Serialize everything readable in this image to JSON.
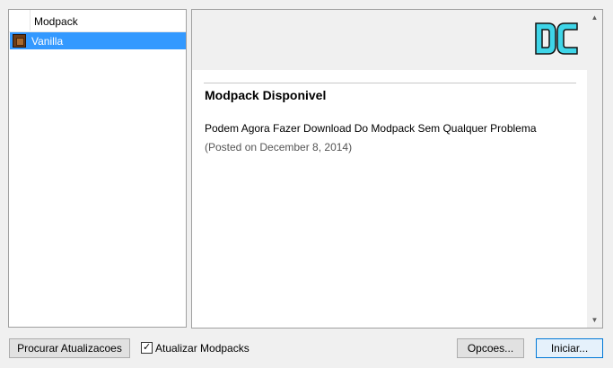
{
  "modpack_list": {
    "column_header": "Modpack",
    "items": [
      {
        "name": "Vanilla",
        "selected": true,
        "icon": "crafting-table-icon"
      }
    ]
  },
  "news": {
    "logo_text": "DC",
    "title": "Modpack Disponivel",
    "body": "Podem Agora Fazer Download Do Modpack Sem Qualquer Problema",
    "date": "(Posted on December 8, 2014)"
  },
  "footer": {
    "update_button": "Procurar Atualizacoes",
    "update_modpacks_label": "Atualizar Modpacks",
    "update_modpacks_checked": true,
    "options_button": "Opcoes...",
    "launch_button": "Iniciar..."
  },
  "colors": {
    "selection": "#3399ff",
    "logo_fill": "#3fd5e8",
    "logo_outline": "#111111"
  }
}
